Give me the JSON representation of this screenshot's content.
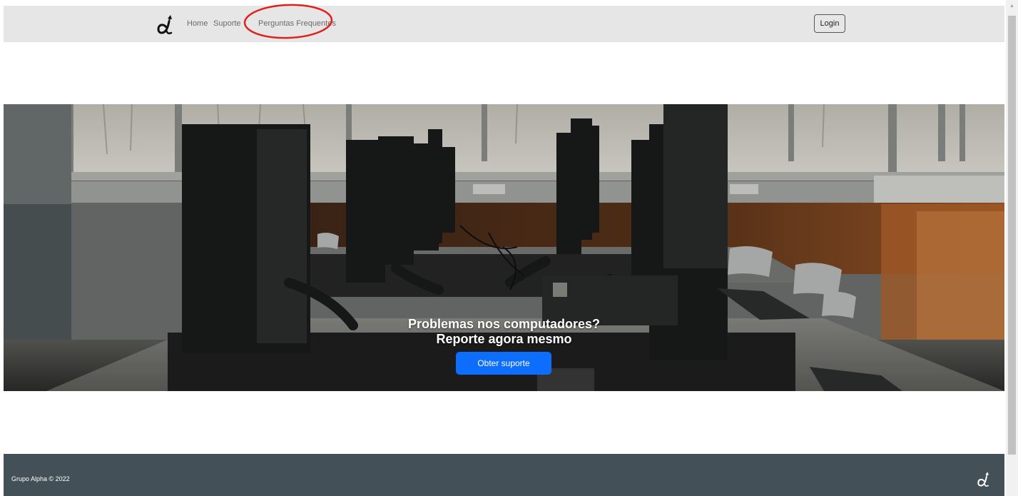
{
  "navbar": {
    "brand_logo": "alpha-logo-icon",
    "links": [
      {
        "label": "Home"
      },
      {
        "label": "Suporte"
      },
      {
        "label": "Perguntas Frequentes"
      }
    ],
    "highlighted_link": "Perguntas Frequentes",
    "login_label": "Login",
    "background_color": "#e6e6e6"
  },
  "hero": {
    "heading_line1": "Problemas nos computadores?",
    "heading_line2": "Reporte agora mesmo",
    "cta_label": "Obter suporte",
    "cta_color": "#0d6efd",
    "background_image": "computer-lab-photo"
  },
  "footer": {
    "copyright": "Grupo Alpha © 2022",
    "logo": "alpha-logo-icon",
    "background_color": "#435058"
  },
  "colors": {
    "highlight_ring": "#e0201b"
  }
}
